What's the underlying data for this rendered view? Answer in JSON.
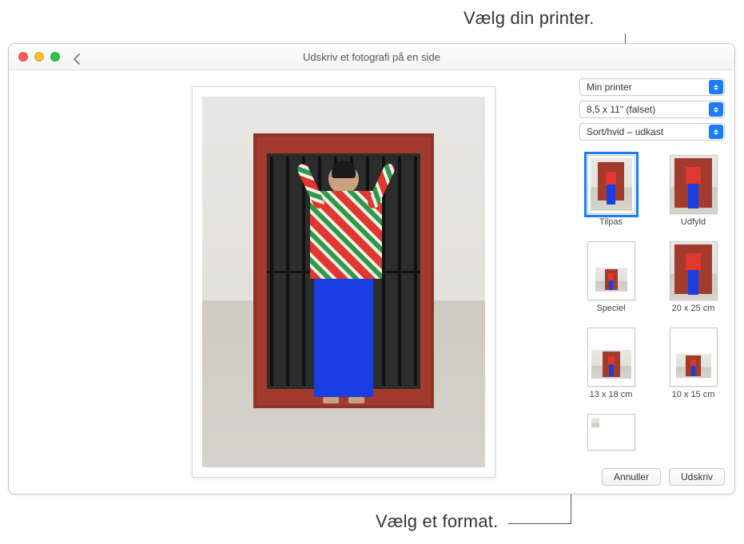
{
  "callouts": {
    "top": "Vælg din printer.",
    "bottom": "Vælg et format."
  },
  "window": {
    "title": "Udskriv et fotografi på en side"
  },
  "dropdowns": {
    "printer": "Min printer",
    "paper": "8,5 x 11\" (falset)",
    "quality": "Sort/hvid – udkast"
  },
  "layouts": [
    {
      "id": "tilpas",
      "label": "Tilpas",
      "selected": true,
      "variant": "fit"
    },
    {
      "id": "udfyld",
      "label": "Udfyld",
      "selected": false,
      "variant": "fill"
    },
    {
      "id": "speciel",
      "label": "Speciel",
      "selected": false,
      "variant": "custom-small"
    },
    {
      "id": "20x25",
      "label": "20 x 25 cm",
      "selected": false,
      "variant": "fill"
    },
    {
      "id": "13x18",
      "label": "13 x 18 cm",
      "selected": false,
      "variant": "landscape-med"
    },
    {
      "id": "10x15",
      "label": "10 x 15 cm",
      "selected": false,
      "variant": "landscape-sm"
    },
    {
      "id": "contact",
      "label": "",
      "selected": false,
      "variant": "contact"
    }
  ],
  "actions": {
    "cancel": "Annuller",
    "print": "Udskriv"
  }
}
